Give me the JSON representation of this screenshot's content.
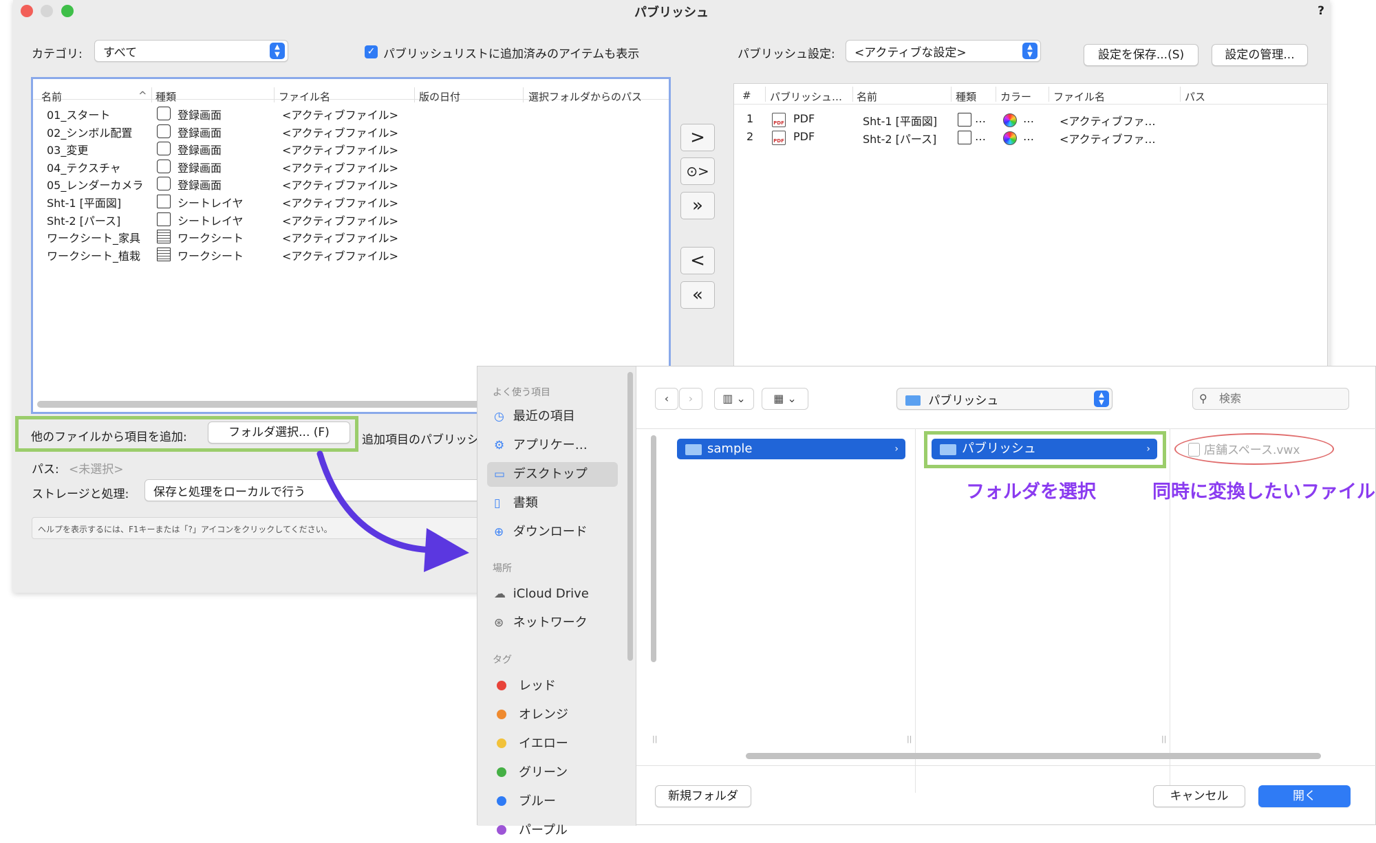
{
  "window": {
    "title": "パブリッシュ",
    "help": "?"
  },
  "controls": {
    "category_label": "カテゴリ:",
    "category_value": "すべて",
    "show_added_label": "パブリッシュリストに追加済みのアイテムも表示",
    "publish_settings_label": "パブリッシュ設定:",
    "publish_settings_value": "<アクティブな設定>",
    "save_settings": "設定を保存...(S)",
    "manage_settings": "設定の管理..."
  },
  "left_list": {
    "headers": [
      "名前",
      "種類",
      "ファイル名",
      "版の日付",
      "選択フォルダからのパス"
    ],
    "rows": [
      {
        "name": "01_スタート",
        "type": "登録画面",
        "file": "<アクティブファイル>",
        "icon": "saved-view-icon"
      },
      {
        "name": "02_シンボル配置",
        "type": "登録画面",
        "file": "<アクティブファイル>",
        "icon": "saved-view-icon"
      },
      {
        "name": "03_変更",
        "type": "登録画面",
        "file": "<アクティブファイル>",
        "icon": "saved-view-icon"
      },
      {
        "name": "04_テクスチャ",
        "type": "登録画面",
        "file": "<アクティブファイル>",
        "icon": "saved-view-icon"
      },
      {
        "name": "05_レンダーカメラ",
        "type": "登録画面",
        "file": "<アクティブファイル>",
        "icon": "saved-view-icon"
      },
      {
        "name": "Sht-1 [平面図]",
        "type": "シートレイヤ",
        "file": "<アクティブファイル>",
        "icon": "sheet-layer-icon"
      },
      {
        "name": "Sht-2 [パース]",
        "type": "シートレイヤ",
        "file": "<アクティブファイル>",
        "icon": "sheet-layer-icon"
      },
      {
        "name": "ワークシート_家具",
        "type": "ワークシート",
        "file": "<アクティブファイル>",
        "icon": "worksheet-icon"
      },
      {
        "name": "ワークシート_植栽",
        "type": "ワークシート",
        "file": "<アクティブファイル>",
        "icon": "worksheet-icon"
      }
    ]
  },
  "right_list": {
    "headers": [
      "#",
      "パブリッシュ…",
      "名前",
      "種類",
      "カラー",
      "ファイル名",
      "パス"
    ],
    "rows": [
      {
        "num": "1",
        "format": "PDF",
        "name": "Sht-1 [平面図]",
        "type_more": "…",
        "color_more": "…",
        "file": "<アクティブファ…"
      },
      {
        "num": "2",
        "format": "PDF",
        "name": "Sht-2 [パース]",
        "type_more": "…",
        "color_more": "…",
        "file": "<アクティブファ…"
      }
    ]
  },
  "bottom": {
    "add_from_label": "他のファイルから項目を追加:",
    "folder_button": "フォルダ選択... (F)",
    "added_items_label": "追加項目のパブリッシ",
    "path_label": "パス:",
    "path_value": "<未選択>",
    "storage_label": "ストレージと処理:",
    "storage_value": "保存と処理をローカルで行う",
    "help_text": "ヘルプを表示するには、F1キーまたは「?」アイコンをクリックしてください。"
  },
  "finder": {
    "sidebar": {
      "favorites_header": "よく使う項目",
      "favorites": [
        {
          "label": "最近の項目",
          "icon": "clock-icon"
        },
        {
          "label": "アプリケー…",
          "icon": "applications-icon"
        },
        {
          "label": "デスクトップ",
          "icon": "desktop-icon"
        },
        {
          "label": "書類",
          "icon": "document-icon"
        },
        {
          "label": "ダウンロード",
          "icon": "download-icon"
        }
      ],
      "locations_header": "場所",
      "locations": [
        {
          "label": "iCloud Drive",
          "icon": "cloud-icon"
        },
        {
          "label": "ネットワーク",
          "icon": "globe-icon"
        }
      ],
      "tags_header": "タグ",
      "tags": [
        {
          "label": "レッド",
          "color": "#e8433a"
        },
        {
          "label": "オレンジ",
          "color": "#ef8a2f"
        },
        {
          "label": "イエロー",
          "color": "#f2c23a"
        },
        {
          "label": "グリーン",
          "color": "#45b045"
        },
        {
          "label": "ブルー",
          "color": "#2f7bf5"
        },
        {
          "label": "パープル",
          "color": "#9d55d6"
        }
      ]
    },
    "location_popup": "パブリッシュ",
    "search_placeholder": "検索",
    "col1_item": "sample",
    "col2_item": "パブリッシュ",
    "col3_item": "店舗スペース.vwx",
    "new_folder": "新規フォルダ",
    "cancel": "キャンセル",
    "open": "開く"
  },
  "annotations": {
    "select_folder": "フォルダを選択",
    "files_to_convert": "同時に変換したいファイル",
    "accent": "#8a3bf0",
    "highlight": "#9bcd6b"
  }
}
